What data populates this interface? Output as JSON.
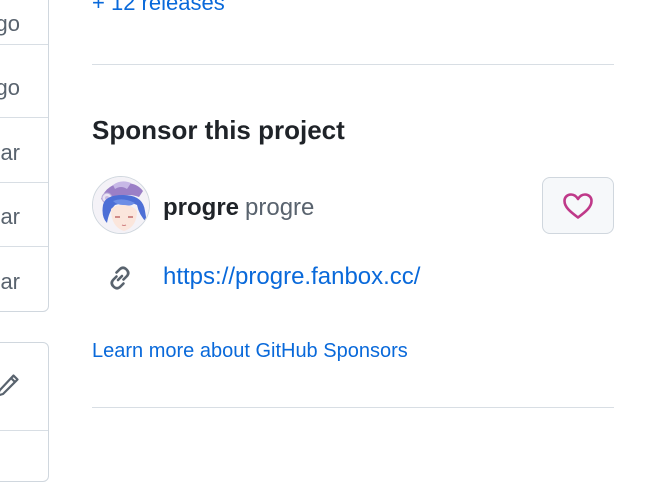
{
  "left_panel": {
    "rows": [
      {
        "age": "go"
      },
      {
        "age": "go"
      },
      {
        "age": "ar"
      },
      {
        "age": "ar"
      },
      {
        "age": "ar"
      }
    ],
    "edit_icon": "pencil-icon"
  },
  "sidebar": {
    "releases_link": "+ 12 releases",
    "sponsor_section": {
      "title": "Sponsor this project",
      "sponsor": {
        "login": "progre",
        "name": "progre",
        "button_icon": "heart-icon"
      },
      "links": [
        {
          "icon": "link-icon",
          "url": "https://progre.fanbox.cc/"
        }
      ],
      "learn_more": "Learn more about GitHub Sponsors"
    }
  },
  "colors": {
    "link": "#0969da",
    "heart": "#bf3989",
    "border": "#d0d7de",
    "muted_text": "#59636e"
  }
}
